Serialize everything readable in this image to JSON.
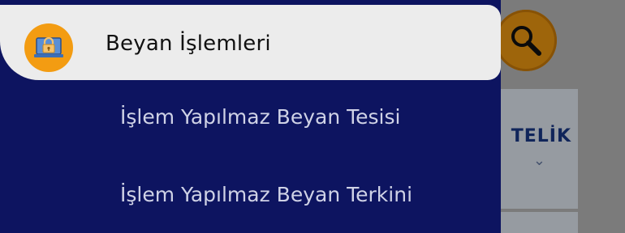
{
  "drawer": {
    "header": {
      "title": "Beyan İşlemleri",
      "icon": "lock-icon"
    },
    "items": [
      {
        "label": "İşlem Yapılmaz Beyan Tesisi"
      },
      {
        "label": "İşlem Yapılmaz Beyan Terkini"
      }
    ]
  },
  "background": {
    "search_icon": "search-icon",
    "card_text": "TELİK"
  },
  "colors": {
    "drawer_bg": "#0d1460",
    "header_bg": "#ececec",
    "accent": "#f39c12",
    "menu_text": "#cfd2e6"
  }
}
